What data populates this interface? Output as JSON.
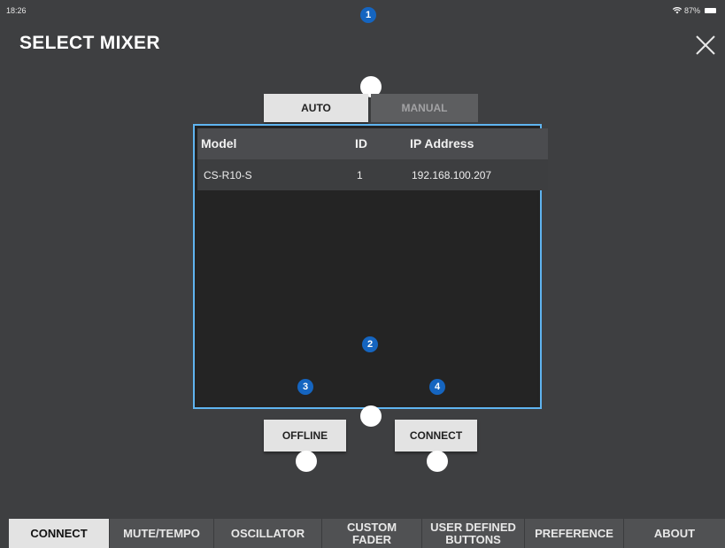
{
  "status": {
    "time": "18:26",
    "battery": "87%"
  },
  "header": {
    "title": "SELECT MIXER",
    "close_icon": "close-icon"
  },
  "mode_tabs": {
    "auto": "AUTO",
    "manual": "MANUAL",
    "selected": "AUTO"
  },
  "table": {
    "columns": [
      "Model",
      "ID",
      "IP Address"
    ],
    "rows": [
      {
        "model": "CS-R10-S",
        "id": "1",
        "ip": "192.168.100.207"
      }
    ]
  },
  "callouts": [
    "1",
    "2",
    "3",
    "4"
  ],
  "buttons": {
    "offline": "OFFLINE",
    "connect": "CONNECT"
  },
  "bottom_tabs": [
    {
      "label": "CONNECT"
    },
    {
      "label": "MUTE/TEMPO"
    },
    {
      "label": "OSCILLATOR"
    },
    {
      "label": "CUSTOM\nFADER"
    },
    {
      "label": "USER DEFINED\nBUTTONS"
    },
    {
      "label": "PREFERENCE"
    },
    {
      "label": "ABOUT"
    }
  ],
  "active_tab": "CONNECT",
  "colors": {
    "accent_outline": "#5fb4f0",
    "callout_badge": "#1565c0",
    "background": "#3e3f41"
  }
}
